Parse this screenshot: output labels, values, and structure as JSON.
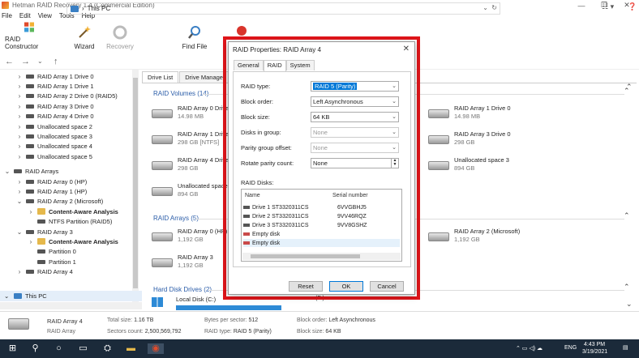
{
  "window": {
    "title": "Hetman RAID Recovery 1.4 (Commercial Edition)",
    "menu": [
      "File",
      "Edit",
      "View",
      "Tools",
      "Help"
    ]
  },
  "toolbar": {
    "raid_constructor": "RAID Constructor",
    "wizard": "Wizard",
    "recovery": "Recovery",
    "find_file": "Find File"
  },
  "address": {
    "path": "This PC"
  },
  "tree": {
    "items": [
      {
        "label": "RAID Array 1 Drive 0",
        "level": 1
      },
      {
        "label": "RAID Array 1 Drive 1",
        "level": 1
      },
      {
        "label": "RAID Array 2 Drive 0 (RAID5)",
        "level": 1
      },
      {
        "label": "RAID Array 3 Drive 0",
        "level": 1
      },
      {
        "label": "RAID Array 4 Drive 0",
        "level": 1
      },
      {
        "label": "Unallocated space 2",
        "level": 1
      },
      {
        "label": "Unallocated space 3",
        "level": 1
      },
      {
        "label": "Unallocated space 4",
        "level": 1
      },
      {
        "label": "Unallocated space 5",
        "level": 1
      },
      {
        "label": "RAID Arrays",
        "level": 0
      },
      {
        "label": "RAID Array 0 (HP)",
        "level": 1
      },
      {
        "label": "RAID Array 1 (HP)",
        "level": 1
      },
      {
        "label": "RAID Array 2 (Microsoft)",
        "level": 1
      },
      {
        "label": "Content-Aware Analysis",
        "level": 2
      },
      {
        "label": "NTFS Partition (RAID5)",
        "level": 2
      },
      {
        "label": "RAID Array 3",
        "level": 1
      },
      {
        "label": "Content-Aware Analysis",
        "level": 2
      },
      {
        "label": "Partition 0",
        "level": 2
      },
      {
        "label": "Partition 1",
        "level": 2
      },
      {
        "label": "RAID Array 4",
        "level": 1
      }
    ],
    "this_pc": "This PC"
  },
  "main": {
    "tabs": [
      "Drive List",
      "Drive Manager"
    ],
    "sections": {
      "volumes": "RAID Volumes (14)",
      "arrays": "RAID Arrays (5)",
      "hdd": "Hard Disk Drives (2)"
    },
    "volumes_left": [
      {
        "name": "RAID Array 0 Drive 0",
        "size": "14.98 MB"
      },
      {
        "name": "RAID Array 1 Drive 1",
        "size": "298 GB [NTFS]"
      },
      {
        "name": "RAID Array 4 Drive 0",
        "size": "298 GB"
      },
      {
        "name": "Unallocated space 4",
        "size": "894 GB"
      }
    ],
    "volumes_right": [
      {
        "name": "RAID Array 1 Drive 0",
        "size": "14.98 MB"
      },
      {
        "name": "RAID Array 3 Drive 0",
        "size": "298 GB"
      },
      {
        "name": "Unallocated space 3",
        "size": "894 GB"
      }
    ],
    "arrays_left": [
      {
        "name": "RAID Array 0 (HP)",
        "size": "1,192 GB"
      },
      {
        "name": "RAID Array 3",
        "size": "1,192 GB"
      }
    ],
    "arrays_right": [
      {
        "name": "RAID Array 2 (Microsoft)",
        "size": "1,192 GB"
      }
    ],
    "hdd_left": {
      "name": "Local Disk (C:)"
    },
    "hdd_right_partial": "(F:)"
  },
  "status": {
    "name": "RAID Array 4",
    "type": "RAID Array",
    "total_size_label": "Total size:",
    "total_size": "1.16 TB",
    "sectors_label": "Sectors count:",
    "sectors": "2,500,569,792",
    "bps_label": "Bytes per sector:",
    "bps": "512",
    "raidtype_label": "RAID type:",
    "raidtype": "RAID 5 (Parity)",
    "blockorder_label": "Block order:",
    "blockorder": "Left Asynchronous",
    "blocksize_label": "Block size:",
    "blocksize": "64 KB"
  },
  "dialog": {
    "title": "RAID Properties: RAID Array 4",
    "tabs": [
      "General",
      "RAID",
      "System"
    ],
    "fields": {
      "raid_type_label": "RAID type:",
      "raid_type": "RAID 5 (Parity)",
      "block_order_label": "Block order:",
      "block_order": "Left Asynchronous",
      "block_size_label": "Block size:",
      "block_size": "64 KB",
      "disks_in_group_label": "Disks in group:",
      "disks_in_group": "None",
      "parity_offset_label": "Parity group offset:",
      "parity_offset": "None",
      "rotate_label": "Rotate parity count:",
      "rotate": "None"
    },
    "raid_disks_label": "RAID Disks:",
    "columns": {
      "name": "Name",
      "serial": "Serial number"
    },
    "disks": [
      {
        "name": "Drive 1 ST3320311CS",
        "serial": "6VVGBHJ5",
        "empty": false
      },
      {
        "name": "Drive 2 ST3320311CS",
        "serial": "9VV46RQZ",
        "empty": false
      },
      {
        "name": "Drive 3 ST3320311CS",
        "serial": "9VV8GSHZ",
        "empty": false
      },
      {
        "name": "Empty disk",
        "serial": "",
        "empty": true
      },
      {
        "name": "Empty disk",
        "serial": "",
        "empty": true
      }
    ],
    "buttons": {
      "reset": "Reset",
      "ok": "OK",
      "cancel": "Cancel"
    }
  },
  "taskbar": {
    "lang": "ENG",
    "time": "4:43 PM",
    "date": "3/19/2021"
  }
}
